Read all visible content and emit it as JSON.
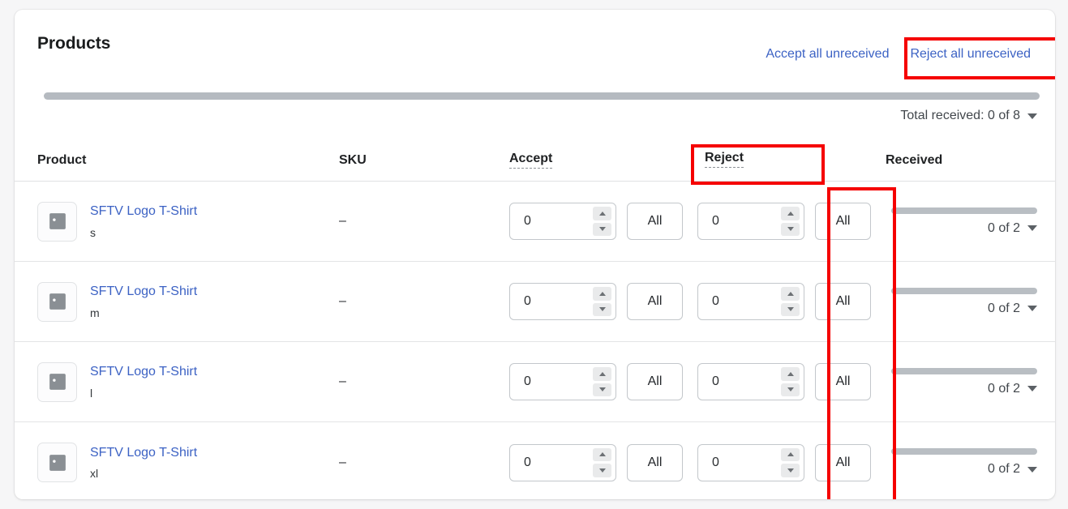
{
  "card": {
    "title": "Products",
    "accept_all_label": "Accept all unreceived",
    "reject_all_label": "Reject all unreceived",
    "total_received_label": "Total received: 0 of 8"
  },
  "table": {
    "headers": {
      "product": "Product",
      "sku": "SKU",
      "accept": "Accept",
      "reject": "Reject",
      "received": "Received"
    },
    "all_button_label": "All",
    "rows": [
      {
        "name": "SFTV Logo T-Shirt",
        "variant": "s",
        "sku": "–",
        "accept_value": "0",
        "reject_value": "0",
        "received_label": "0 of 2",
        "received_progress": 0
      },
      {
        "name": "SFTV Logo T-Shirt",
        "variant": "m",
        "sku": "–",
        "accept_value": "0",
        "reject_value": "0",
        "received_label": "0 of 2",
        "received_progress": 0
      },
      {
        "name": "SFTV Logo T-Shirt",
        "variant": "l",
        "sku": "–",
        "accept_value": "0",
        "reject_value": "0",
        "received_label": "0 of 2",
        "received_progress": 0
      },
      {
        "name": "SFTV Logo T-Shirt",
        "variant": "xl",
        "sku": "–",
        "accept_value": "0",
        "reject_value": "0",
        "received_label": "0 of 2",
        "received_progress": 0
      }
    ]
  },
  "icons": {
    "thumbnail": "image-placeholder-icon",
    "dropdown": "caret-down-icon",
    "stepper_up": "stepper-increment-icon",
    "stepper_down": "stepper-decrement-icon"
  },
  "annotations": {
    "accent_color": "#f50000",
    "boxes": [
      "reject-all-unreceived-link",
      "reject-column-header",
      "reject-all-buttons-column"
    ]
  },
  "colors": {
    "link": "#3c62c4",
    "page_background": "#f6f6f7",
    "card_background": "#ffffff"
  }
}
